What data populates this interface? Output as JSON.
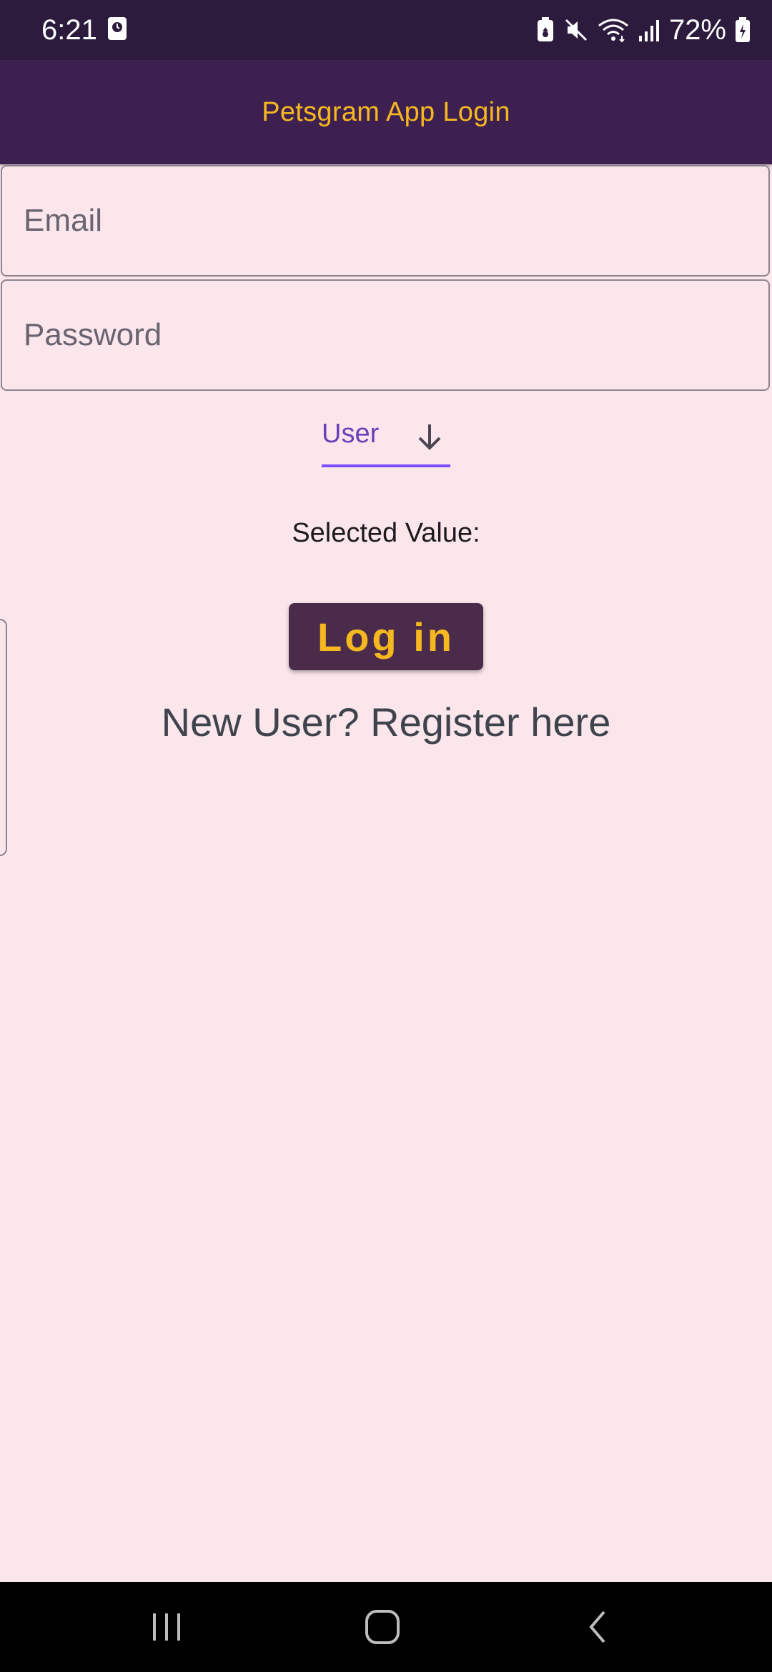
{
  "status_bar": {
    "time": "6:21",
    "battery": "72%",
    "icons": [
      "media-icon",
      "battery-saver-icon",
      "mute-icon",
      "wifi-icon",
      "signal-icon",
      "battery-icon"
    ]
  },
  "app_bar": {
    "title": "Petsgram App Login"
  },
  "form": {
    "email_placeholder": "Email",
    "email_value": "",
    "password_placeholder": "Password",
    "password_value": ""
  },
  "dropdown": {
    "selected": "User",
    "arrow_icon": "arrow-down-icon"
  },
  "selected_value": {
    "label": "Selected Value:"
  },
  "login_button": {
    "label": "Log in"
  },
  "register_link": {
    "label": "New User? Register here"
  },
  "nav_bar": {
    "icons": [
      "recent-apps-icon",
      "home-icon",
      "back-icon"
    ]
  },
  "colors": {
    "background": "#fbe6ec",
    "status_bar": "#2d1b3d",
    "app_bar": "#3d2050",
    "accent_yellow": "#f5b81f",
    "dropdown_text": "#6a3fb8",
    "dropdown_underline": "#7c4dff",
    "button_bg": "#4a2b49"
  }
}
